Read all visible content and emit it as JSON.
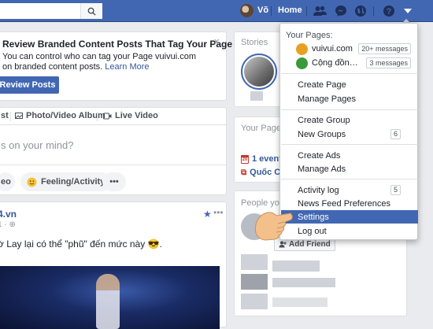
{
  "topbar": {
    "user_name": "Võ",
    "home_label": "Home",
    "icons": [
      "search-icon",
      "friend-requests-icon",
      "messenger-icon",
      "notifications-globe-icon",
      "help-icon",
      "account-menu-caret-icon"
    ]
  },
  "promo": {
    "title": "Review Branded Content Posts That Tag Your Page",
    "text": "You can control who can tag your Page vuivui.com on branded content posts.",
    "link": "Learn More",
    "button": "Review Posts",
    "close": "×"
  },
  "composer": {
    "tabs": [
      "st",
      "Photo/Video Album",
      "Live Video"
    ],
    "placeholder": "s on your mind?",
    "actions": [
      "eo",
      "Feeling/Activity",
      "•••"
    ]
  },
  "post": {
    "source": "4.vn",
    "time": "1 · ⊕",
    "text": "ờ Lay lại có thể \"phũ\" đến mức này 😎.",
    "more": "•••"
  },
  "right": {
    "stories_title": "Stories",
    "pages_title": "Your Page",
    "events": [
      "1 event",
      "Quốc C"
    ],
    "people_title": "People you",
    "add_friend": "Add Friend"
  },
  "menu": {
    "your_pages_label": "Your Pages:",
    "pages": [
      {
        "name": "vuivui.com",
        "badge": "20+ messages",
        "color": "#e8a020"
      },
      {
        "name": "Cộng đồng Bl...",
        "badge": "3 messages",
        "color": "#3a9a3a"
      }
    ],
    "group1": [
      "Create Page",
      "Manage Pages"
    ],
    "group2": [
      "Create Group",
      "New Groups"
    ],
    "new_groups_count": "6",
    "group3": [
      "Create Ads",
      "Manage Ads"
    ],
    "group4": [
      "Activity log",
      "News Feed Preferences",
      "Settings",
      "Log out"
    ],
    "activity_count": "5",
    "active_item": "Settings"
  },
  "colors": {
    "brand_blue": "#4267b2",
    "link_blue": "#365899",
    "background": "#e9ebee"
  }
}
